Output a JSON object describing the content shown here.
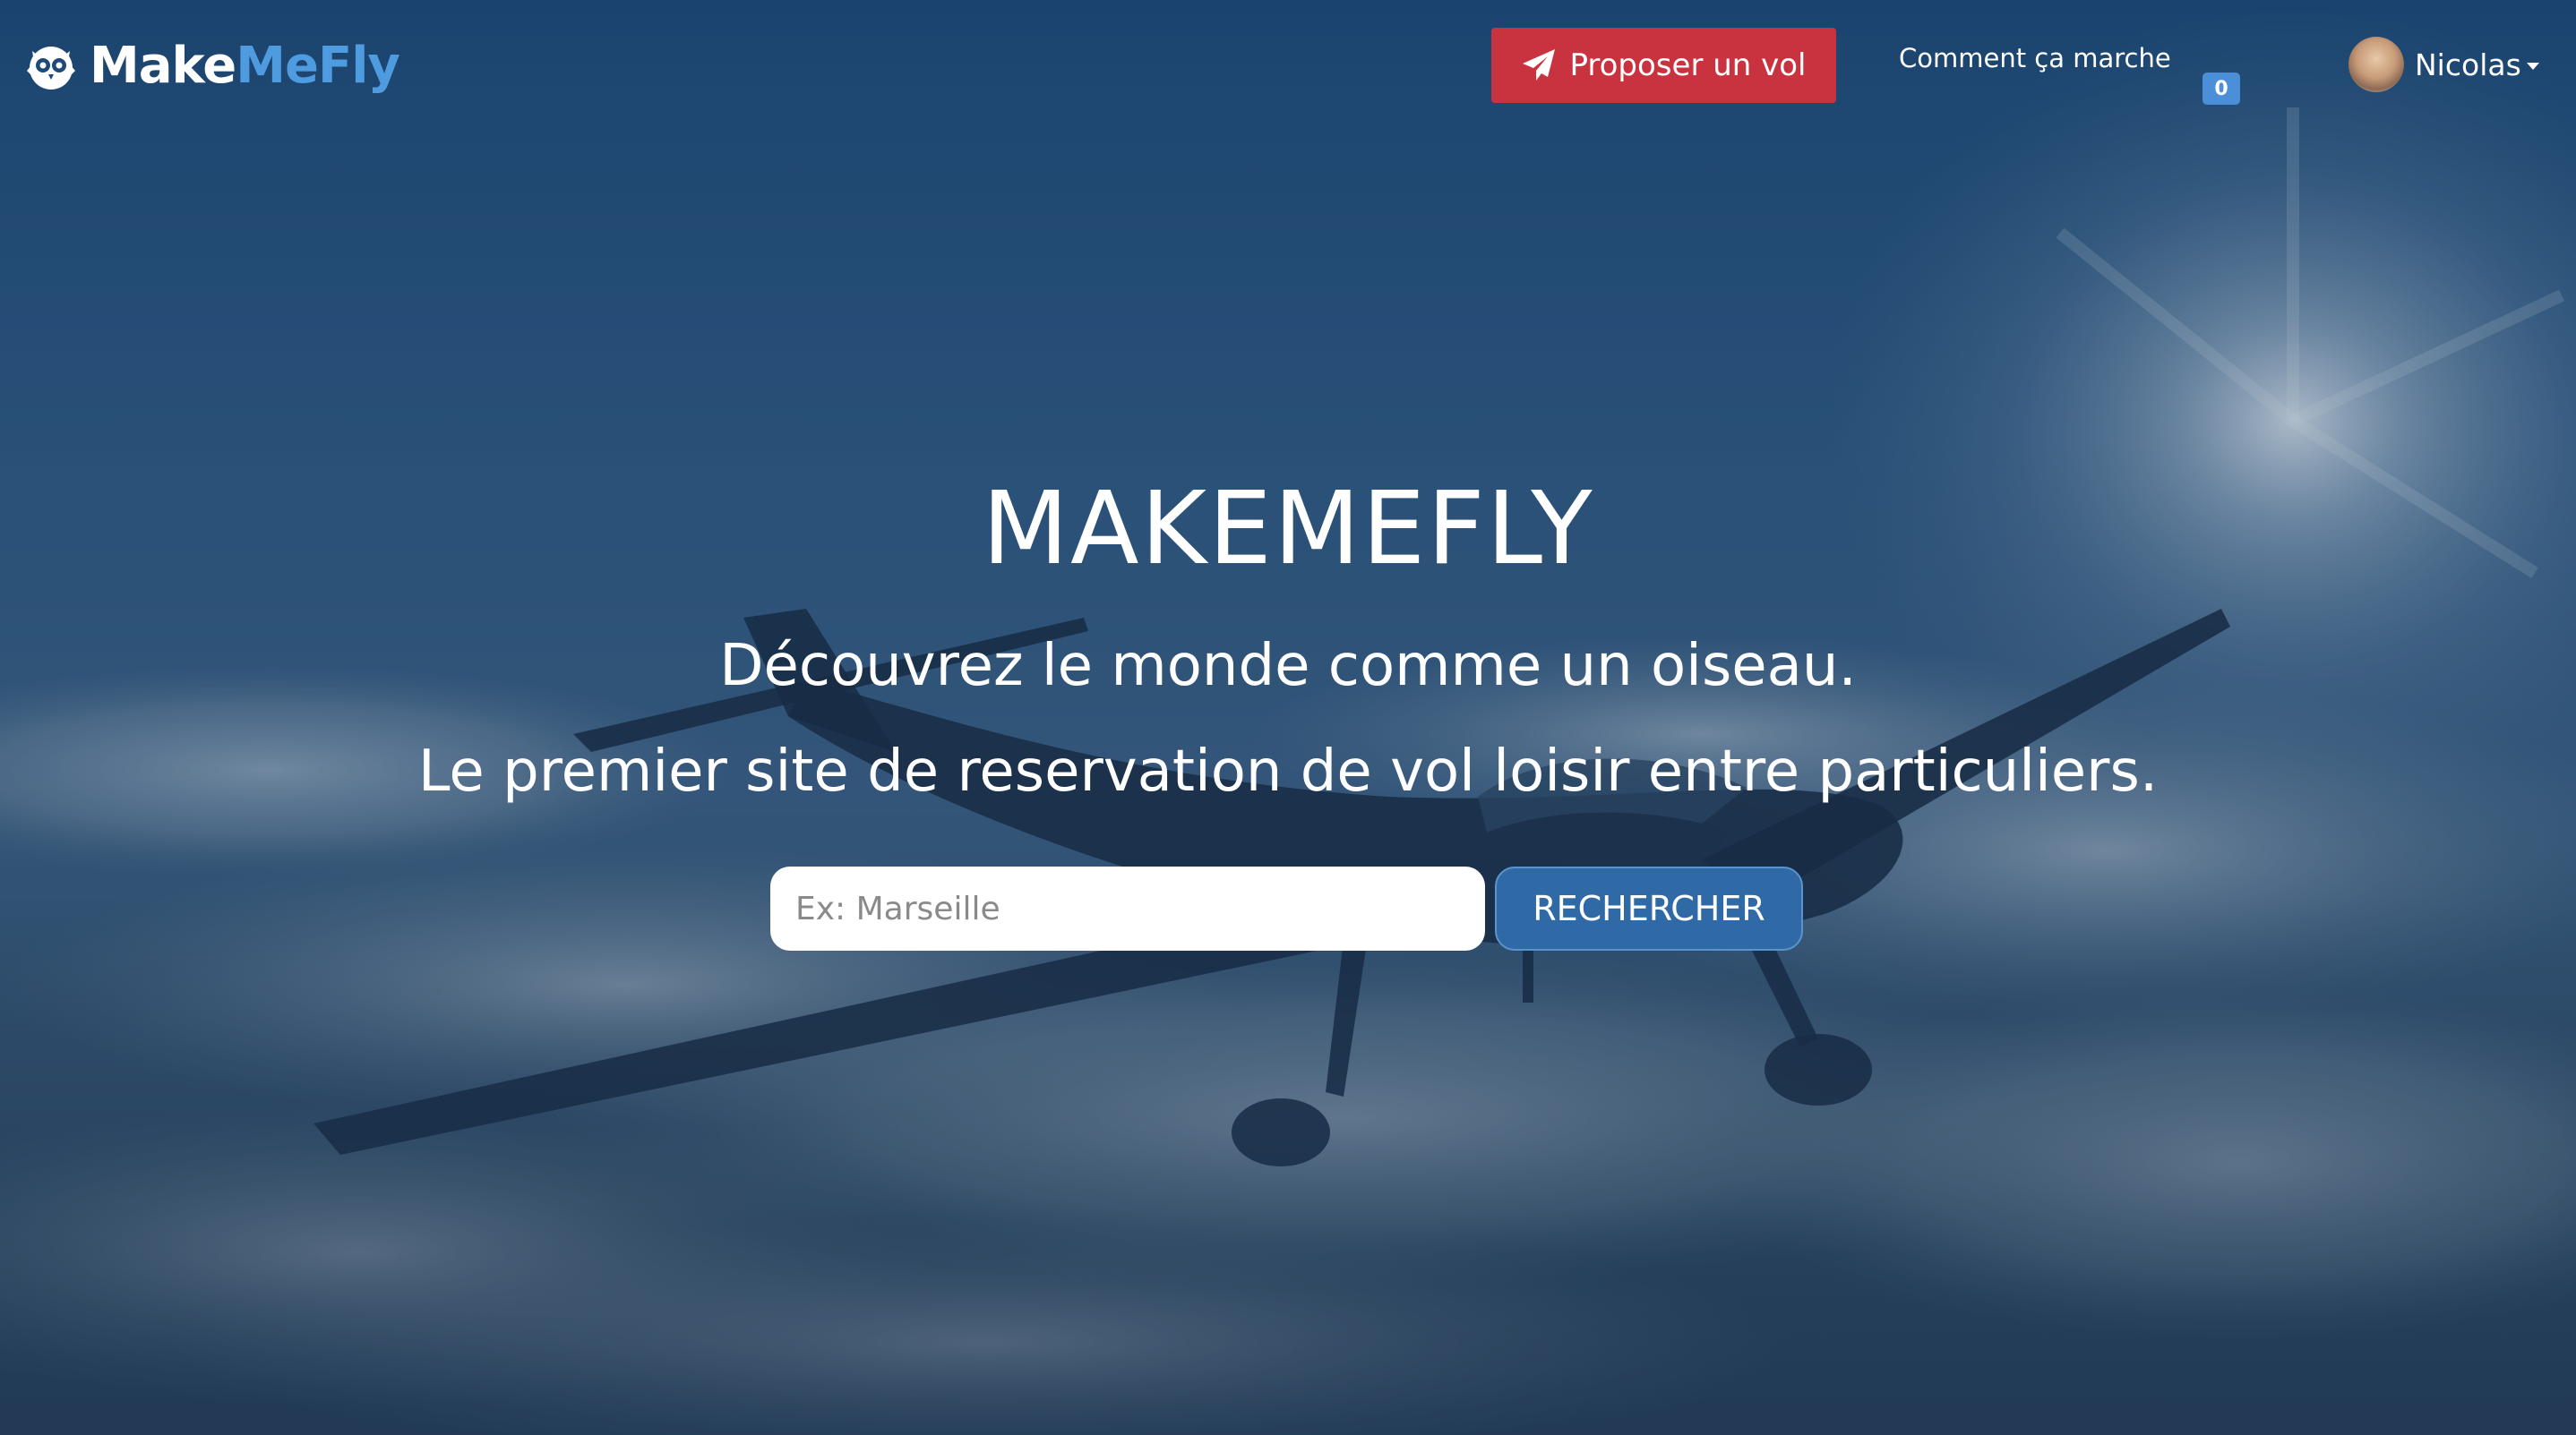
{
  "brand": {
    "name_part1": "Make",
    "name_part2": "MeFly",
    "accent_color": "#4f9be0"
  },
  "navbar": {
    "propose_button_label": "Proposer un vol",
    "propose_button_color": "#c9323f",
    "propose_icon": "paper-plane-icon",
    "how_it_works_label": "Comment ça marche",
    "cart_count": "0",
    "user_name": "Nicolas"
  },
  "hero": {
    "title": "MAKEMEFLY",
    "subtitle_line1": "Découvrez le monde comme un oiseau.",
    "subtitle_line2": "Le premier site de reservation de vol loisir entre particuliers.",
    "background": "airplane-above-clouds"
  },
  "search": {
    "placeholder": "Ex: Marseille",
    "value": "",
    "button_label": "RECHERCHER",
    "button_color": "#2f6aa6"
  }
}
